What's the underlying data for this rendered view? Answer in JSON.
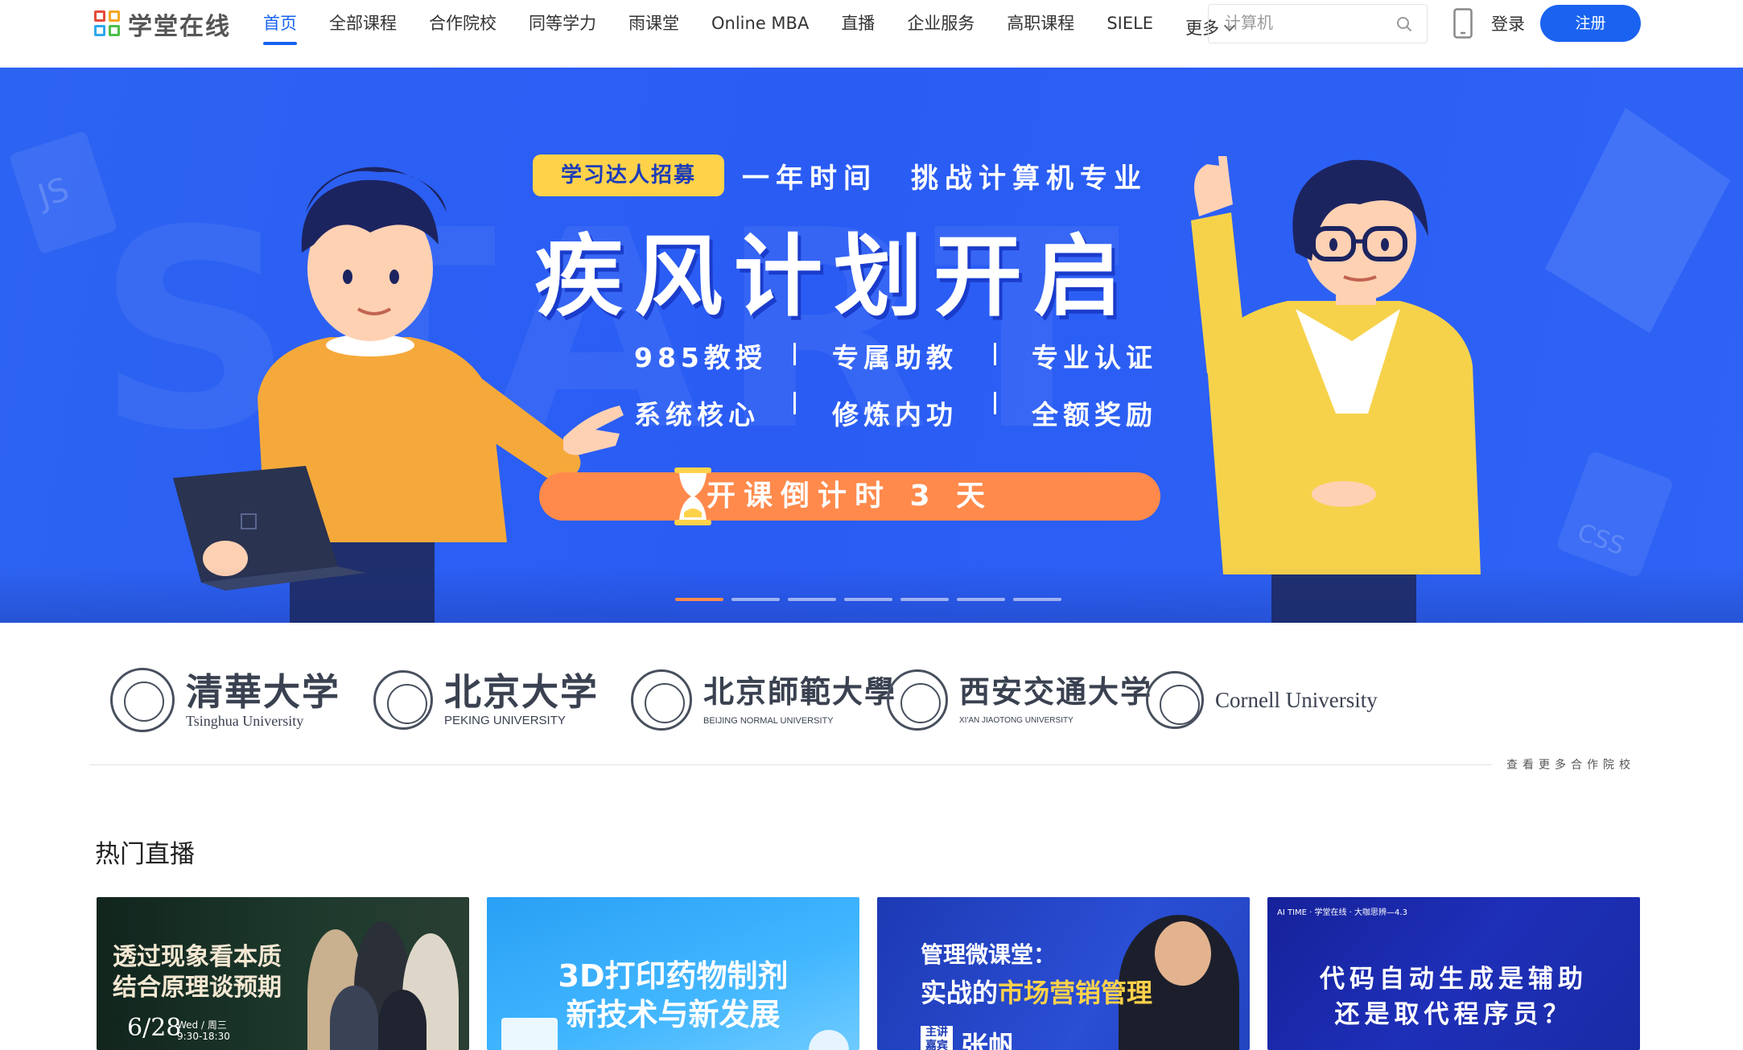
{
  "header": {
    "logo_text": "学堂在线",
    "nav": [
      {
        "label": "首页",
        "active": true
      },
      {
        "label": "全部课程"
      },
      {
        "label": "合作院校"
      },
      {
        "label": "同等学力"
      },
      {
        "label": "雨课堂"
      },
      {
        "label": "Online MBA"
      },
      {
        "label": "直播"
      },
      {
        "label": "企业服务"
      },
      {
        "label": "高职课程"
      },
      {
        "label": "SIELE"
      },
      {
        "label": "更多"
      }
    ],
    "search_placeholder": "计算机",
    "login_label": "登录",
    "register_label": "注册",
    "accent_color": "#1a63f0"
  },
  "banner": {
    "tag": "学习达人招募",
    "subline": "一年时间　挑战计算机专业",
    "headline": "疾风计划开启",
    "features_row1": [
      "985教授",
      "专属助教",
      "专业认证"
    ],
    "features_row2": [
      "系统核心",
      "修炼内功",
      "全额奖励"
    ],
    "countdown": "开课倒计时 3 天",
    "slide_count": 7,
    "active_slide": 1,
    "bg_color": "#2d63f2",
    "button_color": "#ff8a4c"
  },
  "partners": {
    "items": [
      {
        "cn": "清華大学",
        "en": "Tsinghua University"
      },
      {
        "cn": "北京大学",
        "en": "PEKING UNIVERSITY"
      },
      {
        "cn": "北京師範大學",
        "en": "BEIJING NORMAL UNIVERSITY"
      },
      {
        "cn": "西安交通大学",
        "en": "XI'AN JIAOTONG UNIVERSITY"
      },
      {
        "cn": "",
        "en": "Cornell University"
      }
    ],
    "more_label": "查看更多合作院校"
  },
  "live": {
    "title": "热门直播",
    "cards": [
      {
        "title_line1": "透过现象看本质",
        "title_line2": "结合原理谈预期",
        "date": "6/28",
        "weekday": "Wed / 周三",
        "time": "9:30-18:30"
      },
      {
        "title_line1": "3D打印药物制剂",
        "title_line2": "新技术与新发展"
      },
      {
        "title_line1": "管理微课堂：",
        "title_line2_prefix": "实战的",
        "title_line2_highlight": "市场营销管理",
        "badge": "主讲嘉宾",
        "speaker": "张帆"
      },
      {
        "top_text": "AI TIME · 学堂在线 · 大咖思辨—4.3",
        "title_line1": "代码自动生成是辅助",
        "title_line2": "还是取代程序员？"
      }
    ]
  }
}
